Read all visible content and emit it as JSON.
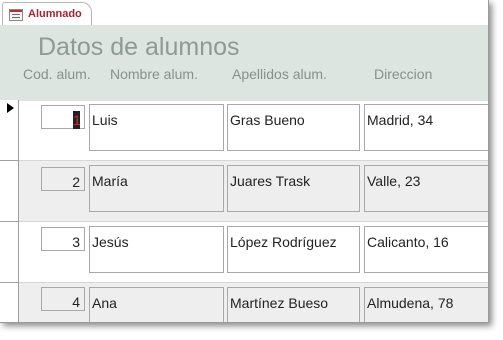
{
  "tab": {
    "label": "Alumnado",
    "icon": "form-icon"
  },
  "form": {
    "title": "Datos de alumnos",
    "columns": [
      "Cod. alum.",
      "Nombre alum.",
      "Apellidos alum.",
      "Direccion"
    ]
  },
  "records": [
    {
      "cod": "1",
      "nombre": "Luis",
      "apellidos": "Gras Bueno",
      "direccion": "Madrid, 34"
    },
    {
      "cod": "2",
      "nombre": "María",
      "apellidos": "Juares Trask",
      "direccion": "Valle, 23"
    },
    {
      "cod": "3",
      "nombre": "Jesús",
      "apellidos": "López Rodríguez",
      "direccion": "Calicanto, 16"
    },
    {
      "cod": "4",
      "nombre": "Ana",
      "apellidos": "Martínez Bueso",
      "direccion": "Almudena, 78"
    }
  ],
  "colors": {
    "header_bg": "#dde5e0",
    "tab_text": "#a8232b",
    "alt_row": "#eeeeee"
  }
}
